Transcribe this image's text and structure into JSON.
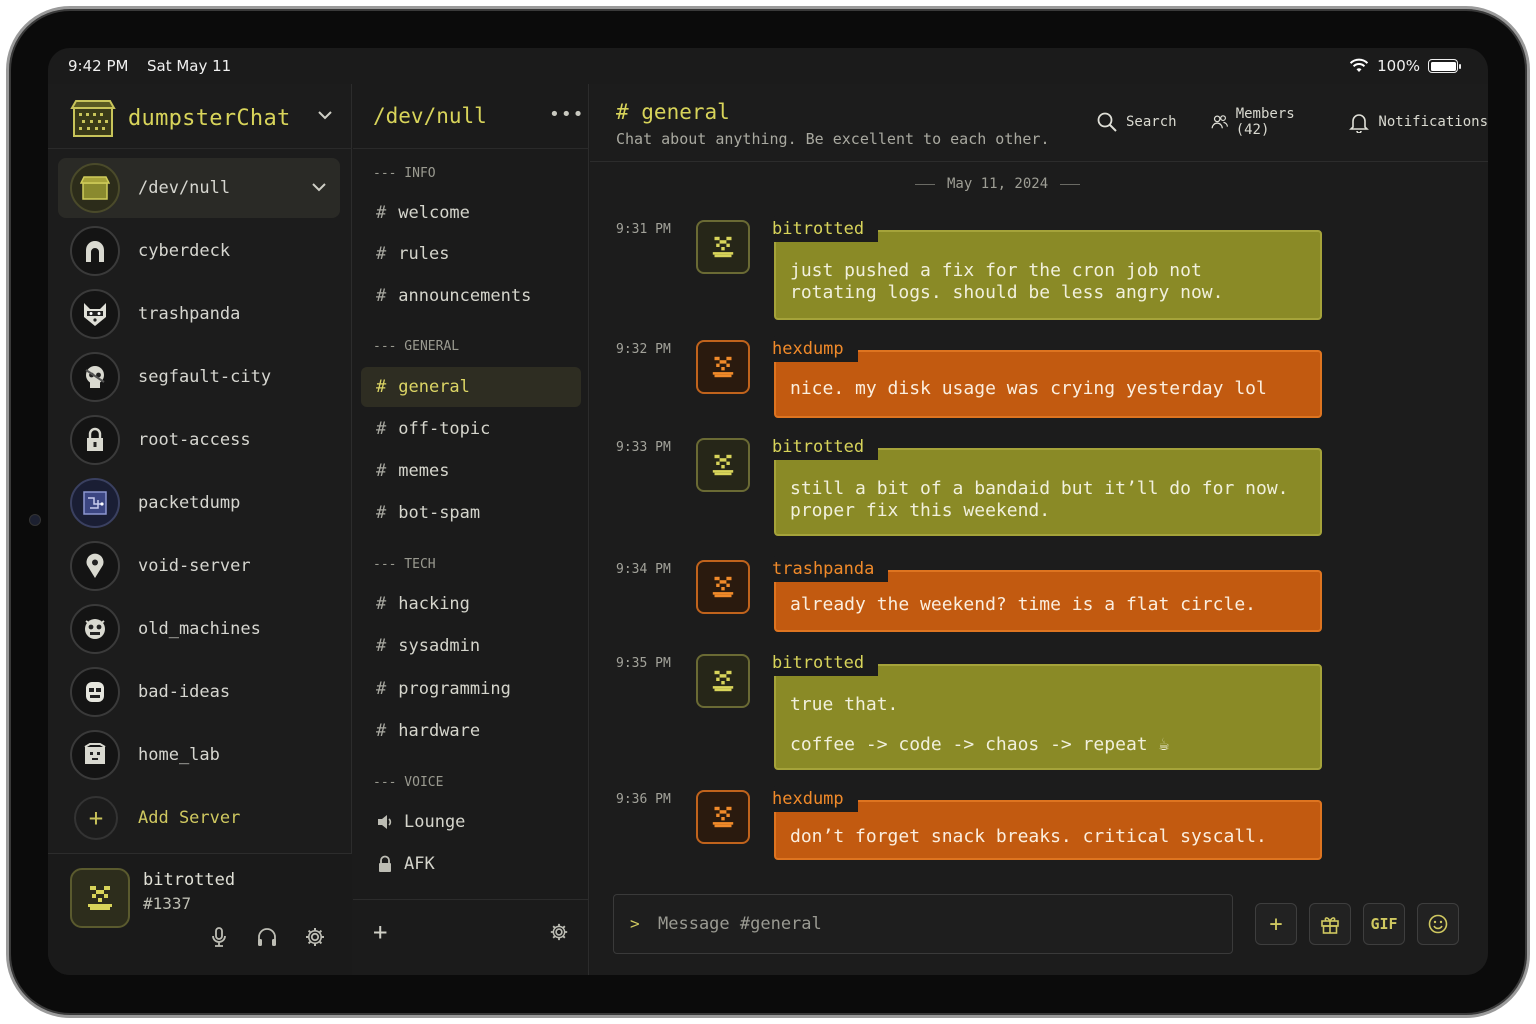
{
  "status": {
    "time": "9:42 PM",
    "date": "Sat May 11",
    "battery": "100%",
    "battery_level": 1.0
  },
  "app": {
    "name": "dumpsterChat"
  },
  "servers": [
    {
      "name": "/dev/null",
      "icon": "dumpster-icon",
      "active": true
    },
    {
      "name": "cyberdeck",
      "icon": "arch-icon"
    },
    {
      "name": "trashpanda",
      "icon": "raccoon-icon"
    },
    {
      "name": "segfault-city",
      "icon": "skull-icon"
    },
    {
      "name": "root-access",
      "icon": "lock-icon"
    },
    {
      "name": "packetdump",
      "icon": "circuit-icon"
    },
    {
      "name": "void-server",
      "icon": "pin-icon"
    },
    {
      "name": "old_machines",
      "icon": "robot-icon"
    },
    {
      "name": "bad-ideas",
      "icon": "face-icon"
    },
    {
      "name": "home_lab",
      "icon": "box-icon"
    }
  ],
  "add_server": "Add Server",
  "user": {
    "name": "bitrotted",
    "tag": "#1337"
  },
  "channel_panel": {
    "title": "/dev/null",
    "more": "•••",
    "categories": [
      {
        "label": "--- INFO",
        "channels": [
          "welcome",
          "rules",
          "announcements"
        ]
      },
      {
        "label": "--- GENERAL",
        "channels": [
          "general",
          "off-topic",
          "memes",
          "bot-spam"
        ]
      },
      {
        "label": "--- TECH",
        "channels": [
          "hacking",
          "sysadmin",
          "programming",
          "hardware"
        ]
      },
      {
        "label": "--- VOICE",
        "channels": [
          "Lounge",
          "AFK"
        ]
      }
    ],
    "active_channel": "general",
    "hash": "#"
  },
  "chat": {
    "title": "# general",
    "topic": "Chat about anything. Be excellent to each other.",
    "actions": {
      "search": "Search",
      "members": "Members (42)",
      "notifications": "Notifications"
    },
    "date_separator": "May 11, 2024",
    "messages": [
      {
        "time": "9:31 PM",
        "author": "bitrotted",
        "color": "olive",
        "text": "just pushed a fix for the cron job not\nrotating logs. should be less angry now."
      },
      {
        "time": "9:32 PM",
        "author": "hexdump",
        "color": "orange",
        "text": "nice. my disk usage was crying yesterday lol"
      },
      {
        "time": "9:33 PM",
        "author": "bitrotted",
        "color": "olive",
        "text": "still a bit of a bandaid but it’ll do for now.\nproper fix this weekend."
      },
      {
        "time": "9:34 PM",
        "author": "trashpanda",
        "color": "orange",
        "text": "already the weekend? time is a flat circle."
      },
      {
        "time": "9:35 PM",
        "author": "bitrotted",
        "color": "olive",
        "text": "true that.",
        "text2": "coffee -> code -> chaos -> repeat ☕"
      },
      {
        "time": "9:36 PM",
        "author": "hexdump",
        "color": "orange",
        "text": "don’t forget snack breaks. critical syscall."
      }
    ],
    "composer": {
      "caret": ">",
      "placeholder": "Message #general"
    },
    "composer_buttons": {
      "plus": "+",
      "gif": "GIF"
    }
  },
  "colors": {
    "accent": "#d8d45a",
    "olive_bubble": "#8a8a26",
    "orange_bubble": "#c25a10",
    "bg": "#1c1c1c"
  }
}
